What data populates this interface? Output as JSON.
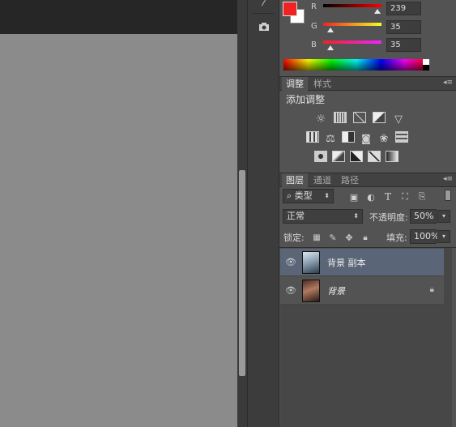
{
  "color_panel": {
    "foreground_color": "#ef2323",
    "background_color": "#ffffff",
    "channels": [
      {
        "label": "R",
        "value": "239",
        "fraction": 0.937
      },
      {
        "label": "G",
        "value": "35",
        "fraction": 0.137
      },
      {
        "label": "B",
        "value": "35",
        "fraction": 0.137
      }
    ]
  },
  "adjustments_panel": {
    "tabs": [
      {
        "label": "调整",
        "active": true
      },
      {
        "label": "样式",
        "active": false
      }
    ],
    "title": "添加调整",
    "icon_rows": [
      [
        "brightness-contrast-icon",
        "levels-icon",
        "curves-icon",
        "exposure-icon",
        "vibrance-icon"
      ],
      [
        "hue-saturation-icon",
        "color-balance-icon",
        "black-white-icon",
        "photo-filter-icon",
        "channel-mixer-icon",
        "color-lookup-icon"
      ],
      [
        "invert-icon",
        "posterize-icon",
        "threshold-icon",
        "selective-color-icon",
        "gradient-map-icon"
      ]
    ]
  },
  "layers_panel": {
    "tabs": [
      {
        "label": "图层",
        "active": true
      },
      {
        "label": "通道",
        "active": false
      },
      {
        "label": "路径",
        "active": false
      }
    ],
    "filter_label": "类型",
    "blend_mode": "正常",
    "opacity_label": "不透明度:",
    "opacity_value": "50%",
    "lock_label": "锁定:",
    "fill_label": "填充:",
    "fill_value": "100%",
    "layers": [
      {
        "name": "背景 副本",
        "selected": true,
        "locked": false
      },
      {
        "name": "背景",
        "selected": false,
        "locked": true
      }
    ]
  }
}
